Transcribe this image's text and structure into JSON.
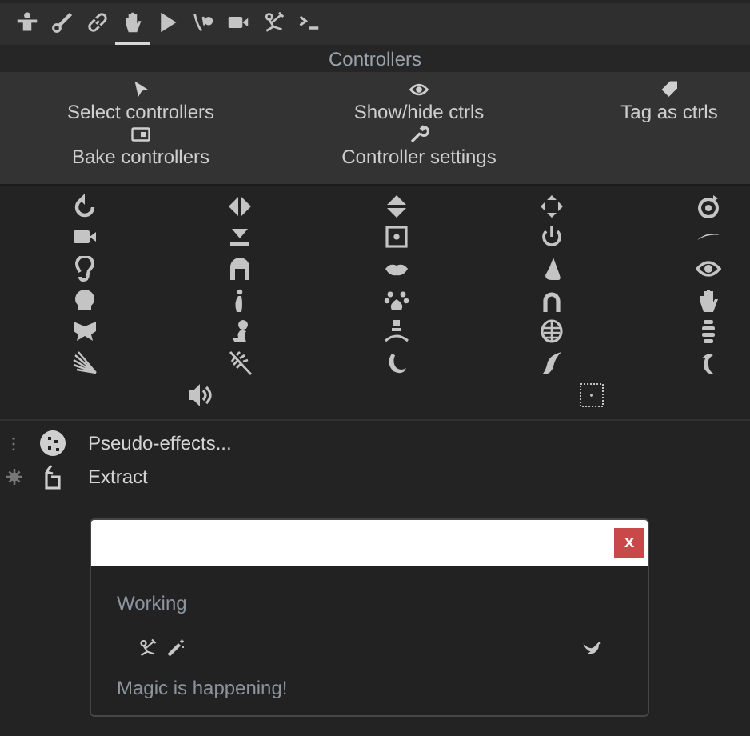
{
  "toolbar": [
    {
      "selected": false
    },
    {
      "selected": false
    },
    {
      "selected": false
    },
    {
      "selected": true
    },
    {
      "selected": false
    },
    {
      "selected": false
    },
    {
      "selected": false
    },
    {
      "selected": false
    },
    {
      "selected": false
    }
  ],
  "panel_title": "Controllers",
  "actions": [
    {
      "label": "Select controllers"
    },
    {
      "label": "Show/hide ctrls"
    },
    {
      "label": "Tag as ctrls"
    },
    {
      "label": "Bake controllers"
    },
    {
      "label": "Controller settings"
    }
  ],
  "list": [
    {
      "label": "Pseudo-effects..."
    },
    {
      "label": "Extract"
    }
  ],
  "dialog": {
    "close": "x",
    "status": "Working",
    "message": "Magic is happening!"
  }
}
